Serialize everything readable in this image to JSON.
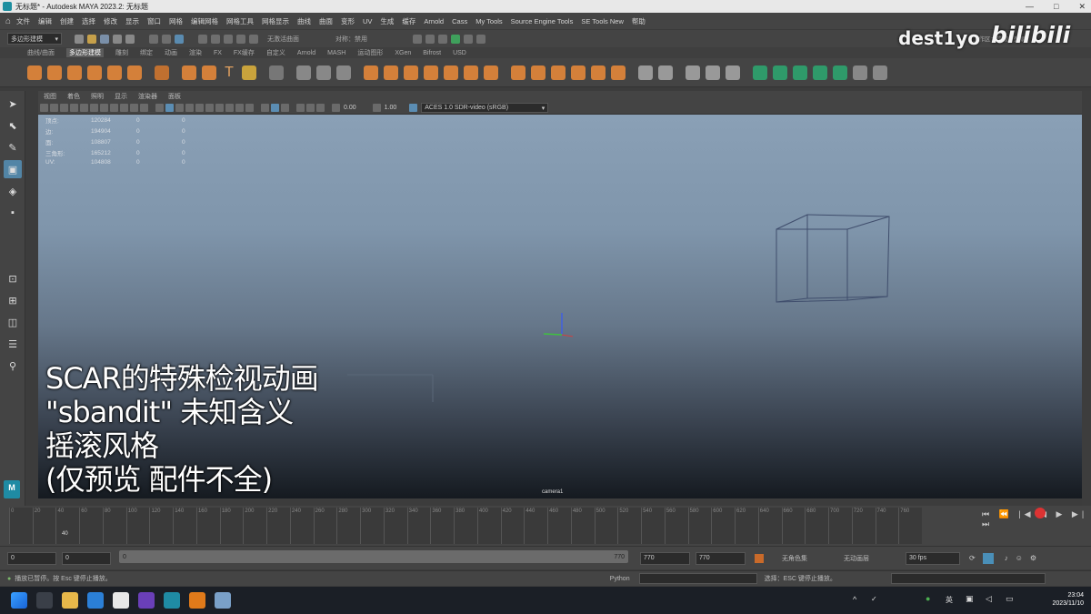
{
  "window": {
    "title": "无标题* - Autodesk MAYA 2023.2: 无标题",
    "controls": [
      "—",
      "□",
      "✕"
    ]
  },
  "menubar": {
    "items": [
      "文件",
      "编辑",
      "创建",
      "选择",
      "修改",
      "显示",
      "窗口",
      "网格",
      "编辑网格",
      "网格工具",
      "网格显示",
      "曲线",
      "曲面",
      "变形",
      "UV",
      "生成",
      "缓存",
      "Arnold",
      "Cass",
      "My Tools",
      "Source Engine Tools",
      "SE Tools New",
      "帮助"
    ]
  },
  "statusline": {
    "mode": "多边形建模",
    "live_label": "无激活曲面",
    "symmetry": "对称：禁用",
    "workspace": "工作区：常规",
    "login": "登录"
  },
  "shelf": {
    "tabs": [
      "曲线/曲面",
      "多边形建模",
      "雕刻",
      "绑定",
      "动画",
      "渲染",
      "FX",
      "FX缓存",
      "自定义",
      "Arnold",
      "MASH",
      "运动图形",
      "XGen",
      "Bifrost",
      "USD"
    ],
    "active_tab": "多边形建模"
  },
  "panel": {
    "menus": [
      "视图",
      "着色",
      "照明",
      "显示",
      "渲染器",
      "面板"
    ],
    "exposure": "0.00",
    "gamma": "1.00",
    "colorspace": "ACES 1.0 SDR-video (sRGB)"
  },
  "hud": {
    "rows": [
      {
        "label": "顶点:",
        "a": "120284",
        "b": "0",
        "c": "0"
      },
      {
        "label": "边:",
        "a": "194904",
        "b": "0",
        "c": "0"
      },
      {
        "label": "面:",
        "a": "108807",
        "b": "0",
        "c": "0"
      },
      {
        "label": "三角形:",
        "a": "165212",
        "b": "0",
        "c": "0"
      },
      {
        "label": "UV:",
        "a": "104808",
        "b": "0",
        "c": "0"
      }
    ]
  },
  "viewport": {
    "camera": "camera1"
  },
  "caption": {
    "lines": [
      "SCAR的特殊检视动画",
      "\"sbandit\" 未知含义",
      "摇滚风格",
      "(仅预览 配件不全)"
    ]
  },
  "watermark": {
    "user": "dest1yo",
    "site": "bilibili"
  },
  "timeslider": {
    "tick_labels": [
      "0",
      "20",
      "40",
      "60",
      "80",
      "100",
      "120",
      "140",
      "160",
      "180",
      "200",
      "220",
      "240",
      "260",
      "280",
      "300",
      "320",
      "340",
      "360",
      "380",
      "400",
      "420",
      "440",
      "460",
      "480",
      "500",
      "520",
      "540",
      "560",
      "580",
      "600",
      "620",
      "640",
      "660",
      "680",
      "700",
      "720",
      "740",
      "760"
    ],
    "current_frame": "40",
    "playback_icons": "⏮ ⏪ |◀ ◀ ▶ ▶| ⏭"
  },
  "rangeslider": {
    "start": "0",
    "anim_start": "0",
    "range_start": "0",
    "range_end": "770",
    "anim_end": "770",
    "end": "770",
    "char_set": "无角色集",
    "anim_layer": "无动画层",
    "fps": "30 fps"
  },
  "cmdline": {
    "message": "播放已暂停。按 Esc 键停止播放。",
    "lang": "Python",
    "help": "选择：ESC 键停止播放。"
  },
  "taskbar": {
    "time": "23:04",
    "date": "2023/11/10",
    "ime": "英"
  },
  "colors": {
    "accent": "#5285a6",
    "maya_teal": "#1f8ba4",
    "play_red": "#dd3333"
  }
}
